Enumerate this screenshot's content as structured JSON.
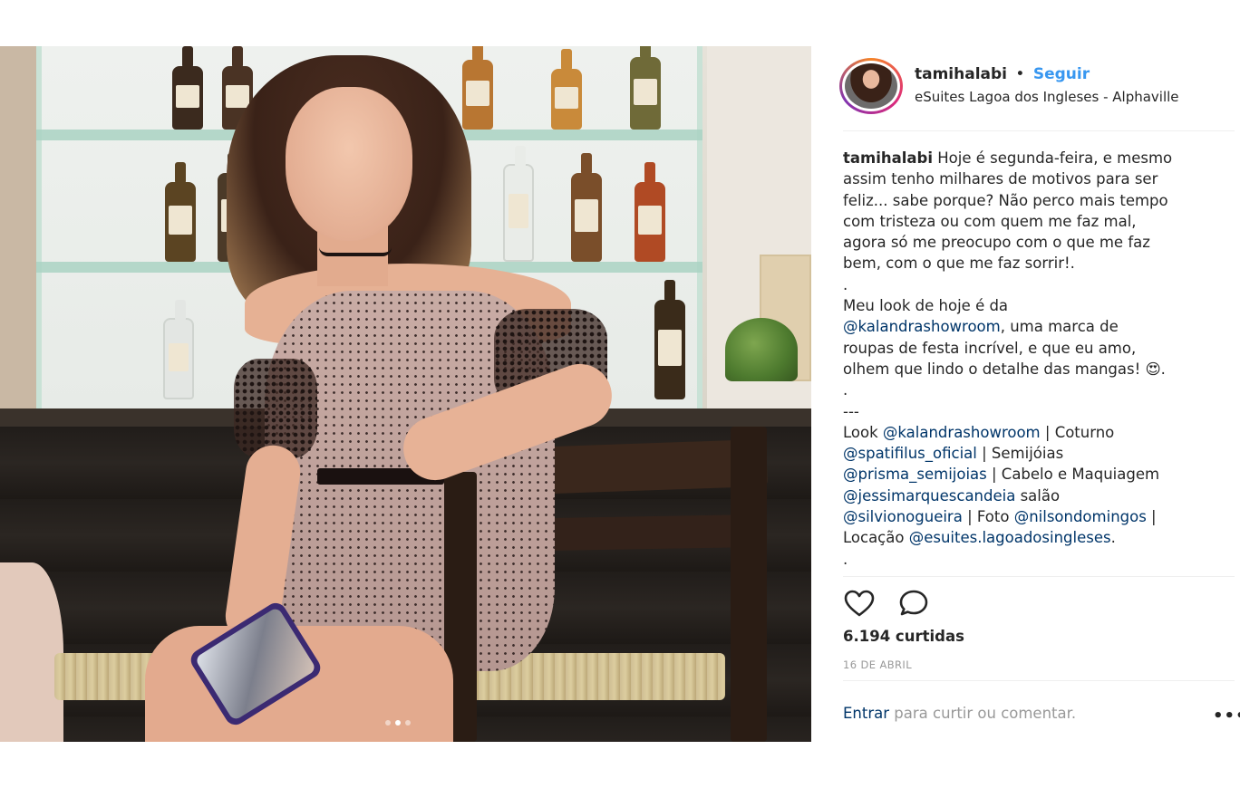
{
  "post": {
    "username": "tamihalabi",
    "separator": "•",
    "follow_label": "Seguir",
    "location": "eSuites Lagoa dos Ingleses - Alphaville"
  },
  "caption": {
    "username": "tamihalabi",
    "text_lines": [
      "Hoje é segunda-feira, e mesmo",
      "assim tenho milhares de motivos para ser",
      "feliz... sabe porque? Não perco mais tempo",
      "com tristeza ou com quem me faz mal,",
      "agora só me preocupo com o que me faz",
      "bem, com o que me faz sorrir!.",
      ".",
      "Meu look de hoje é da",
      ", uma marca de",
      "roupas de festa incrível, e que eu amo,",
      "olhem que lindo o detalhe das mangas! 😍.",
      ".",
      "---",
      "Look ",
      " | Coturno",
      " | Semijóias",
      " | Cabelo e Maquiagem",
      " salão",
      " | Foto ",
      " |",
      "Locação ",
      ".",
      "."
    ],
    "mentions": {
      "kalandra": "@kalandrashowroom",
      "spatifilus": "@spatifilus_oficial",
      "prisma": "@prisma_semijoias",
      "jessi": "@jessimarquescandeia",
      "silvio": "@silvionogueira",
      "nilson": "@nilsondomingos",
      "esuites": "@esuites.lagoadosingleses"
    }
  },
  "stats": {
    "likes": "6.194 curtidas",
    "date": "16 DE ABRIL"
  },
  "footer": {
    "login_link": "Entrar",
    "login_text": " para curtir ou comentar.",
    "more": "•••"
  },
  "carousel": {
    "total": 3,
    "active_index": 1
  },
  "icons": {
    "like": "heart-icon",
    "comment": "comment-icon",
    "more": "more-options-icon"
  },
  "colors": {
    "link": "#003569",
    "follow": "#3897f0",
    "muted": "#999999",
    "text": "#262626"
  }
}
